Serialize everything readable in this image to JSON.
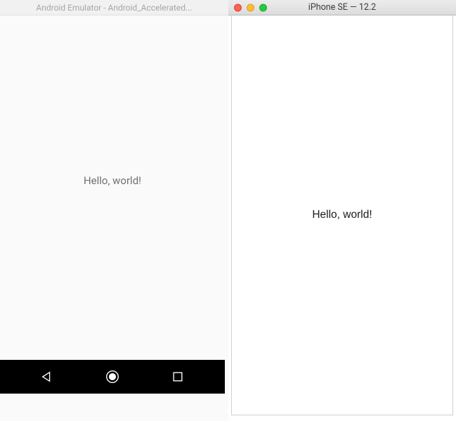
{
  "android": {
    "title": "Android Emulator - Android_Accelerated...",
    "hello_text": "Hello, world!",
    "nav": {
      "back": "back-triangle",
      "home": "home-circle",
      "recent": "recent-square"
    }
  },
  "iphone": {
    "title": "iPhone SE — 12.2",
    "hello_text": "Hello, world!",
    "traffic": {
      "close": "close",
      "minimize": "minimize",
      "zoom": "zoom"
    }
  }
}
